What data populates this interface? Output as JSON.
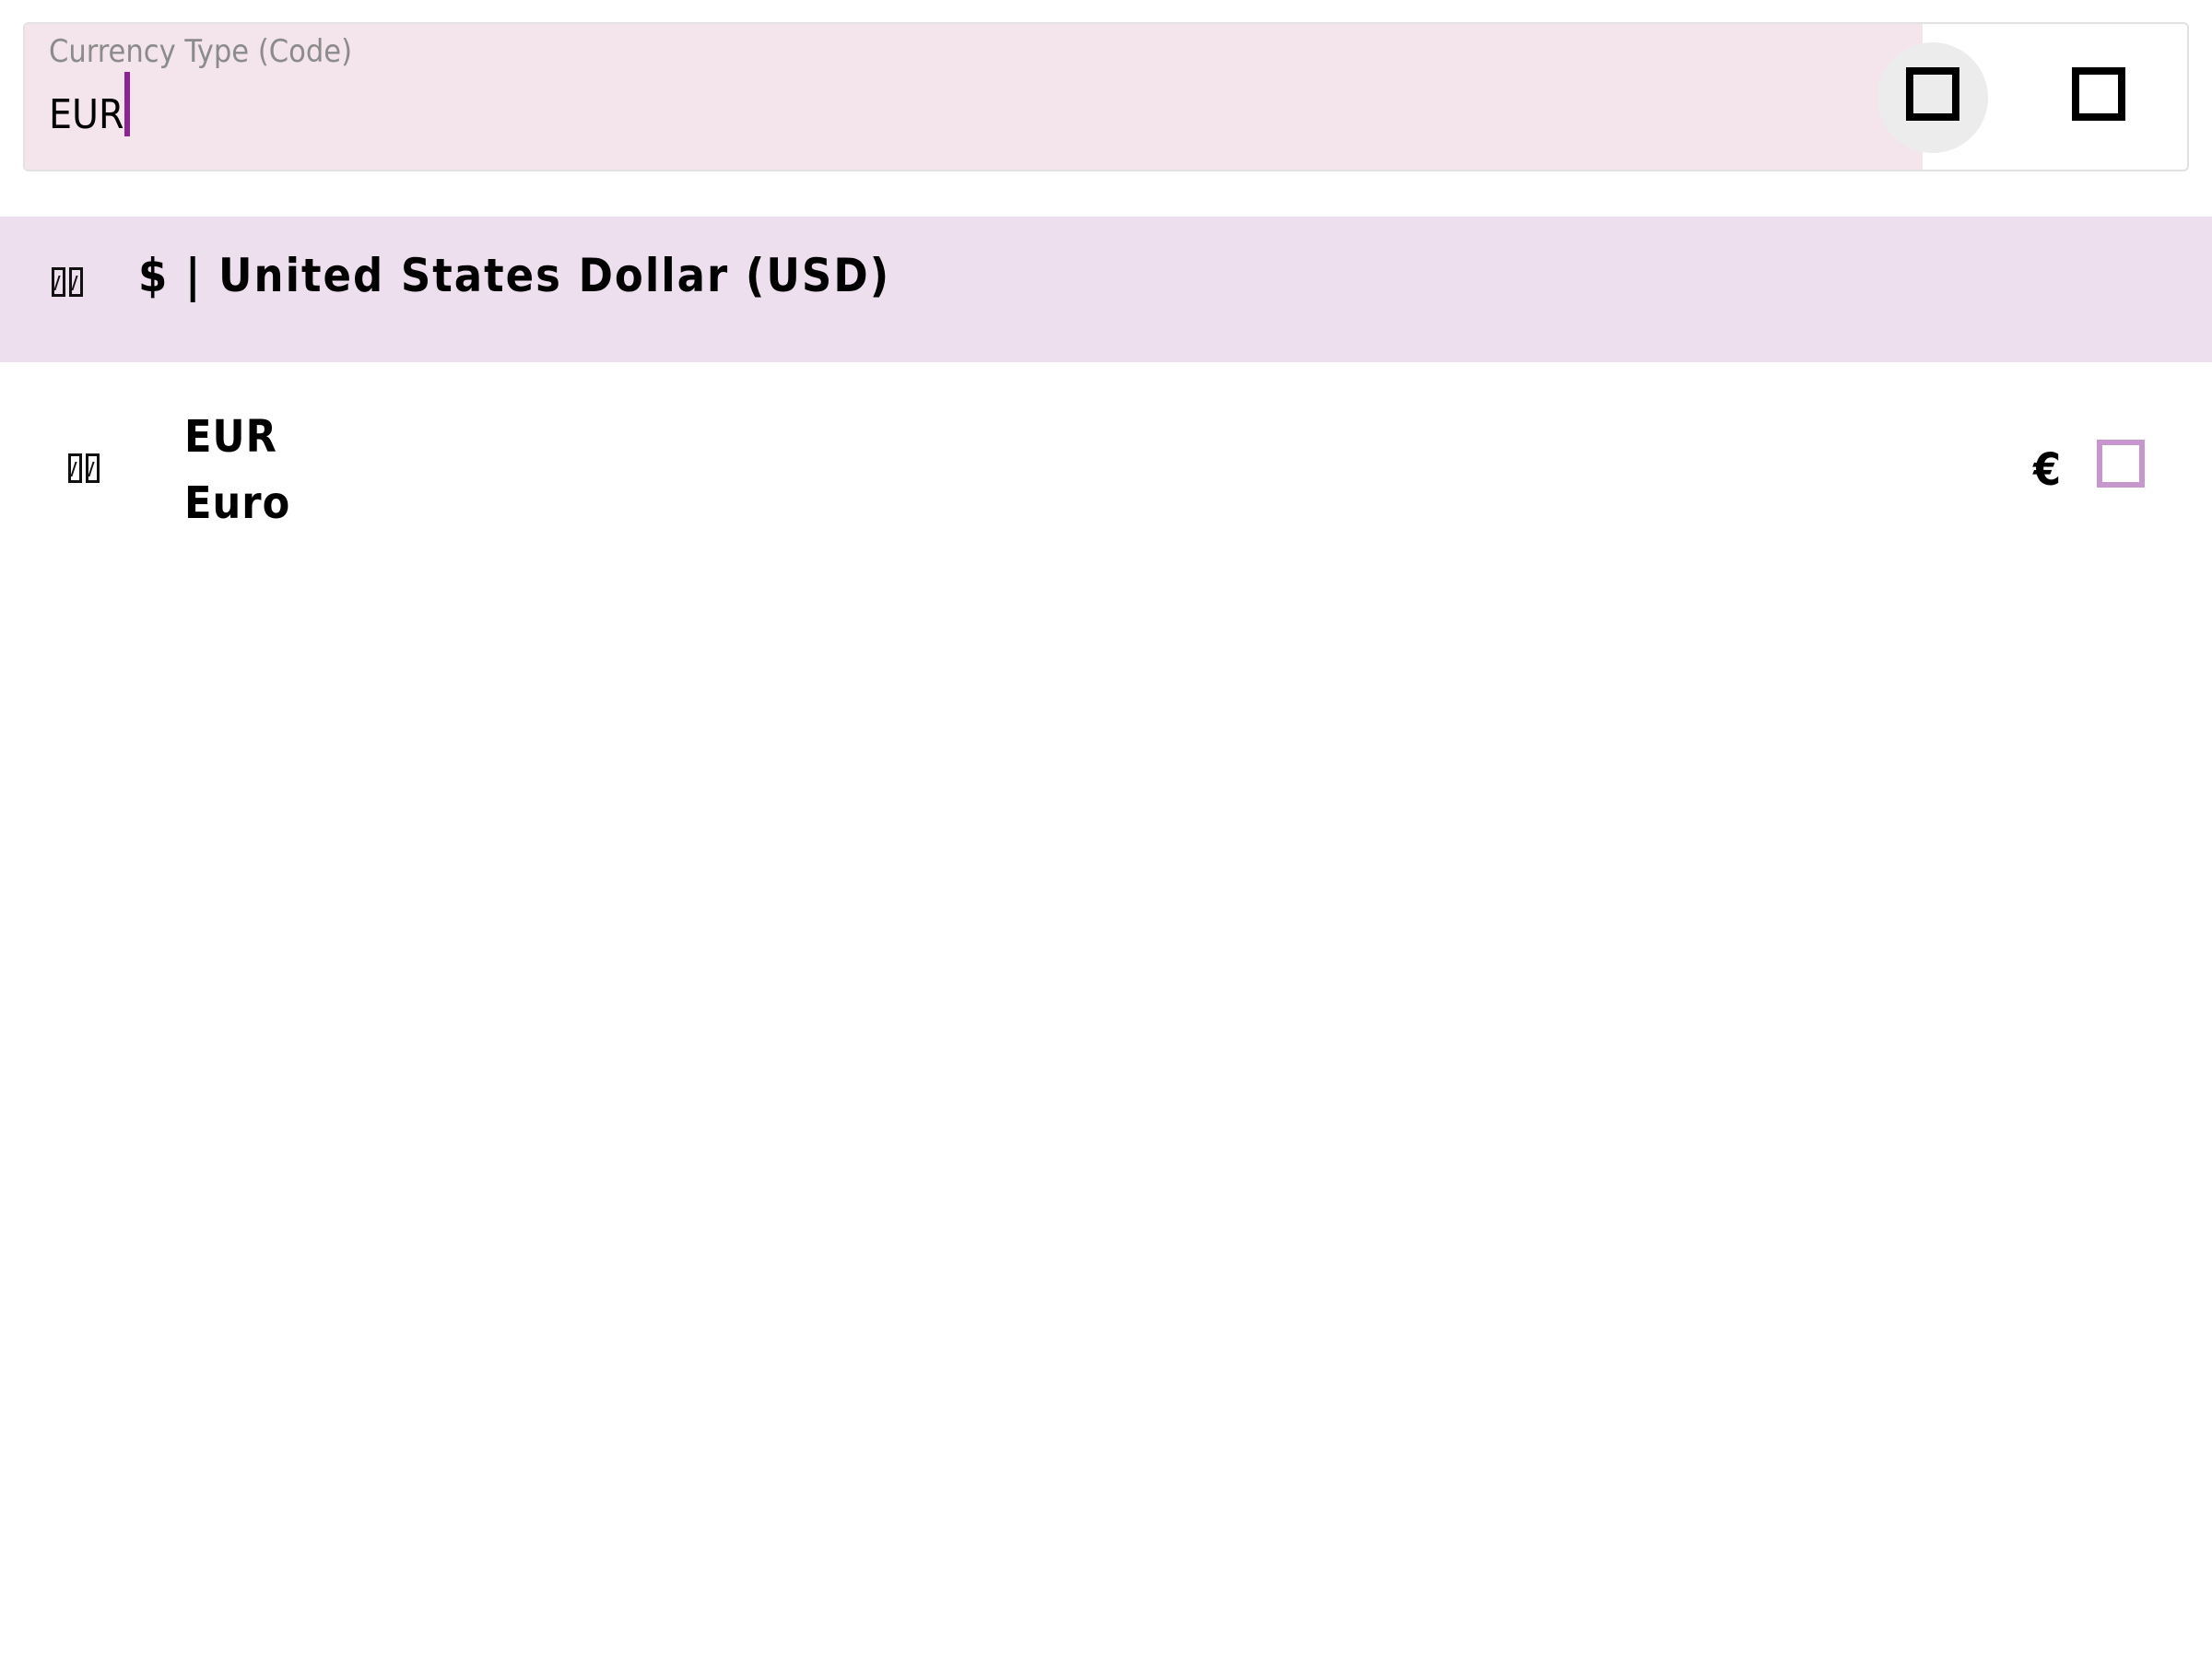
{
  "search": {
    "label": "Currency Type (Code)",
    "value": "EUR",
    "placeholder": ""
  },
  "actions": {
    "primary_icon": "square-icon",
    "secondary_icon": "square-icon"
  },
  "selected": {
    "flag_icon": "flag-icon",
    "label": "$ | United States Dollar (USD)"
  },
  "results": [
    {
      "flag_icon": "flag-icon",
      "code": "EUR",
      "name": "Euro",
      "symbol": "€",
      "checked": false
    }
  ],
  "colors": {
    "search_fill": "#f4e4eb",
    "selected_row": "#eedfee",
    "caret": "#8a2591",
    "checkbox_border": "#c896cf"
  }
}
